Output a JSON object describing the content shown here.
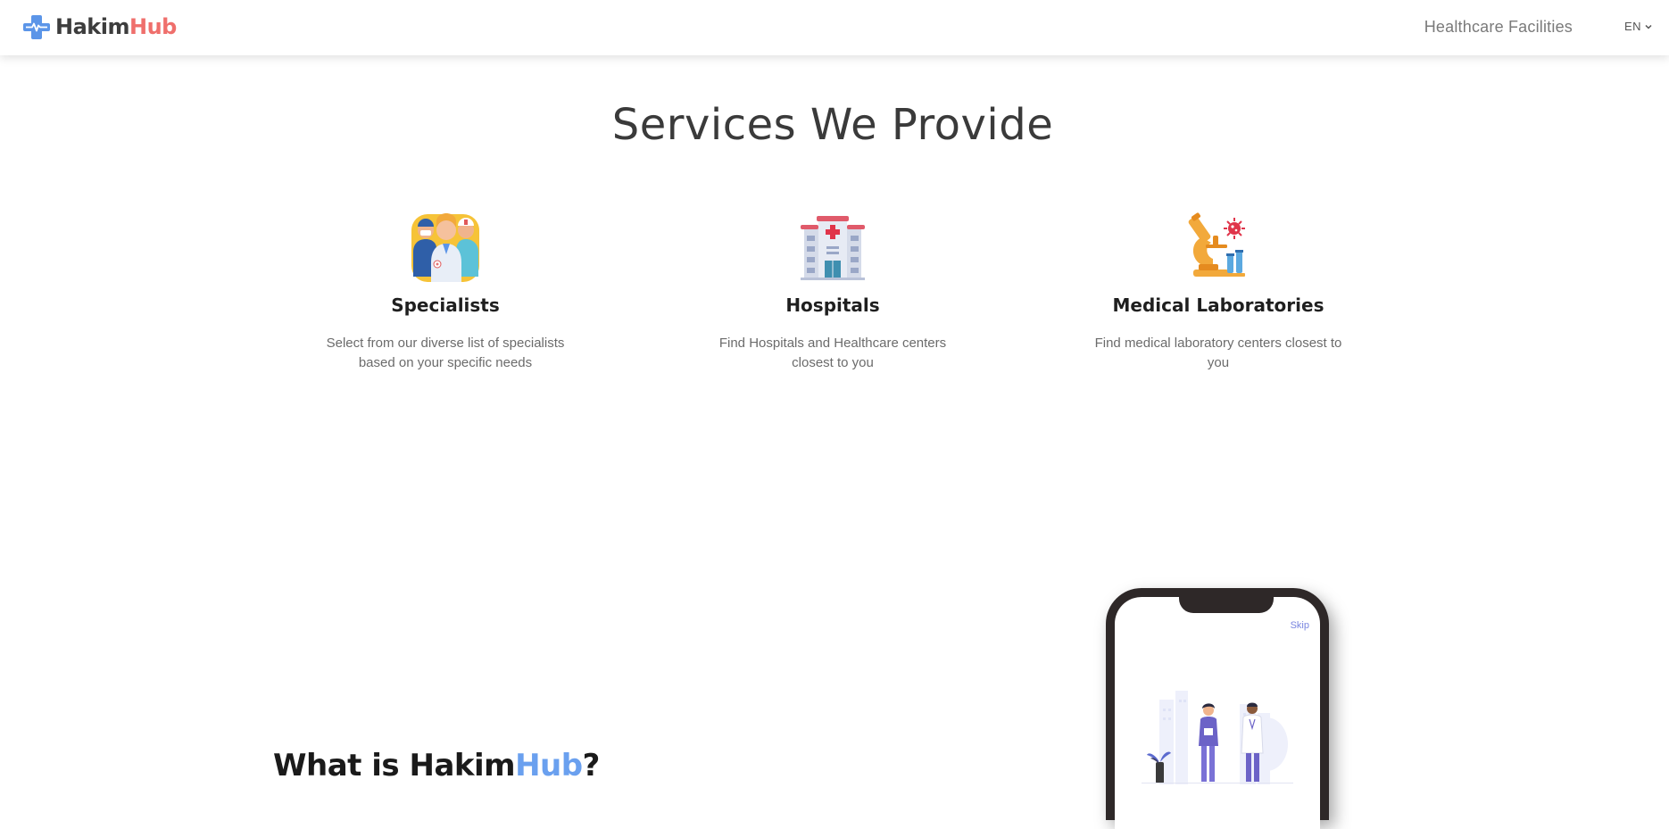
{
  "brand": {
    "name_part1": "Hakim",
    "name_part2": "Hub",
    "colors": {
      "dark": "#3d3d3d",
      "accent": "#ef6f6c",
      "blue": "#6aa0ef"
    }
  },
  "header": {
    "nav_link": "Healthcare Facilities",
    "language": "EN",
    "language_icon": "chevron-down-icon"
  },
  "services": {
    "title": "Services We Provide",
    "items": [
      {
        "icon": "doctors-group-icon",
        "title": "Specialists",
        "description": "Select from our diverse list of specialists based on your specific needs"
      },
      {
        "icon": "hospital-icon",
        "title": "Hospitals",
        "description": "Find Hospitals and Healthcare centers closest to you"
      },
      {
        "icon": "microscope-icon",
        "title": "Medical Laboratories",
        "description": "Find medical laboratory centers closest to you"
      }
    ]
  },
  "about": {
    "title_prefix": "What is ",
    "title_part1": "Hakim",
    "title_part2": "Hub",
    "title_suffix": "?"
  },
  "phone": {
    "skip_label": "Skip"
  }
}
